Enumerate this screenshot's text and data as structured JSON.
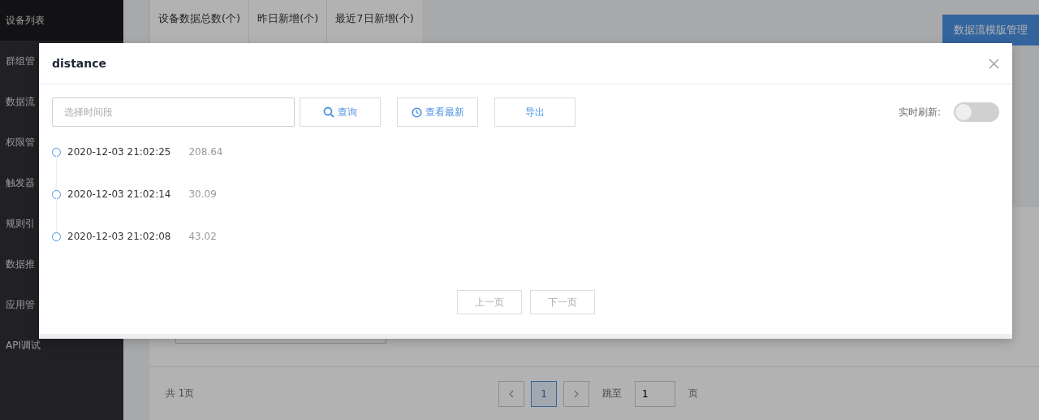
{
  "sidebar": {
    "items": [
      {
        "label": "设备列表",
        "selected": true
      },
      {
        "label": "群组管"
      },
      {
        "label": "数据流"
      },
      {
        "label": "权限管"
      },
      {
        "label": "触发器"
      },
      {
        "label": "规则引"
      },
      {
        "label": "数据推"
      },
      {
        "label": "应用管"
      },
      {
        "label": "API调试"
      }
    ]
  },
  "stats": [
    {
      "label": "设备数据总数(个)"
    },
    {
      "label": "昨日新增(个)"
    },
    {
      "label": "最近7日新增(个)"
    }
  ],
  "template_button": "数据流模版管理",
  "pagination": {
    "total": "共 1页",
    "pages": [
      {
        "label": "1",
        "selected": true
      }
    ],
    "jump_label": "跳至",
    "jump_value": "1",
    "unit": "页"
  },
  "dialog": {
    "title": "distance",
    "time_range": {
      "placeholder": "选择时间段"
    },
    "buttons": [
      {
        "kind": "search",
        "label": "查询"
      },
      {
        "kind": "latest",
        "label": "查看最新"
      },
      {
        "kind": "plain",
        "label": "导出"
      }
    ],
    "realtime": {
      "label": "实时刷新:",
      "on": false
    },
    "records": [
      {
        "time": "2020-12-03 21:02:25",
        "value": "208.64"
      },
      {
        "time": "2020-12-03 21:02:14",
        "value": "30.09"
      },
      {
        "time": "2020-12-03 21:02:08",
        "value": "43.02"
      }
    ],
    "pager": [
      {
        "label": "上一页",
        "disabled": true
      },
      {
        "label": "下一页",
        "disabled": true
      }
    ]
  }
}
